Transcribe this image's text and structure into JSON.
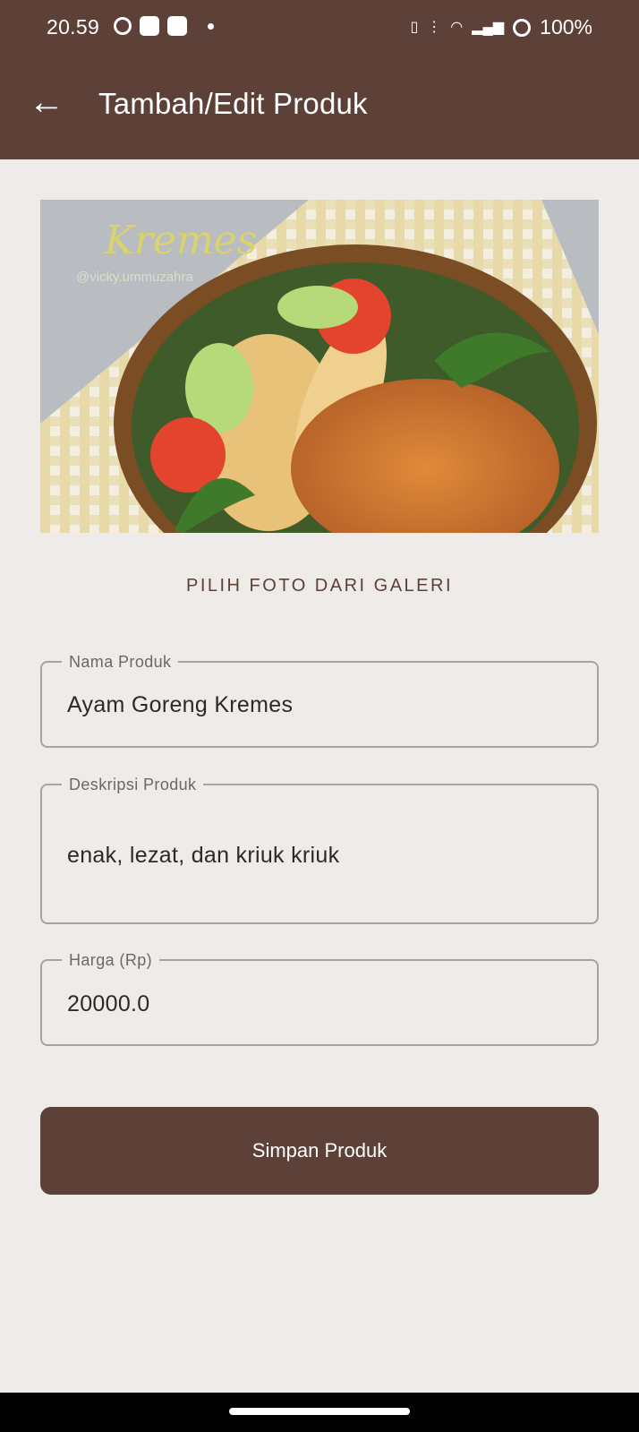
{
  "status_bar": {
    "time": "20.59",
    "battery": "100%",
    "left_icons": [
      "sync-icon",
      "whatsapp-icon",
      "bag-icon",
      "dot-icon"
    ],
    "right_icons": [
      "vibrate-icon",
      "volte-icon",
      "wifi-icon",
      "signal-icon",
      "battery-ring-icon"
    ]
  },
  "app_bar": {
    "title": "Tambah/Edit Produk",
    "back_icon": "arrow-left-icon"
  },
  "photo": {
    "caption_script": "Kremes",
    "watermark": "@vicky.ummuzahra"
  },
  "gallery_button": "PILIH FOTO DARI GALERI",
  "form": {
    "name": {
      "label": "Nama Produk",
      "value": "Ayam Goreng Kremes"
    },
    "description": {
      "label": "Deskripsi Produk",
      "value": "enak, lezat, dan kriuk kriuk"
    },
    "price": {
      "label": "Harga (Rp)",
      "value": "20000.0"
    }
  },
  "save_button": "Simpan Produk",
  "colors": {
    "primary": "#5d4037",
    "background": "#efebe9",
    "outline": "#a7a3a1"
  }
}
